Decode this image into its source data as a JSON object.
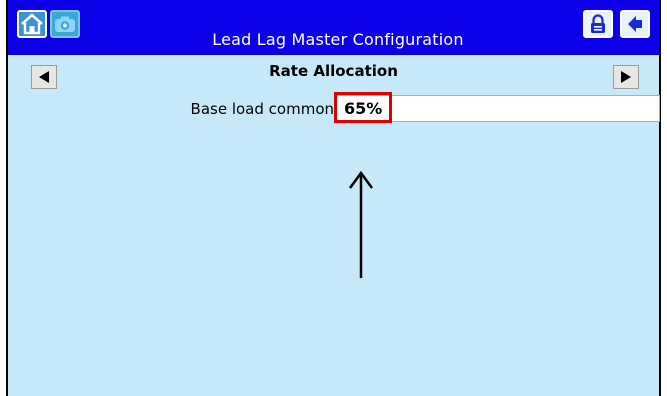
{
  "window": {
    "title": "Lead Lag Master Configuration"
  },
  "toolbar": {
    "home_icon": "home-icon",
    "camera_icon": "camera-icon",
    "lock_icon": "lock-icon",
    "back_icon": "back-arrow-icon"
  },
  "section": {
    "title": "Rate Allocation",
    "prev_icon": "left-arrow-icon",
    "next_icon": "right-arrow-icon"
  },
  "fields": [
    {
      "label": "Base load common",
      "value": "65%"
    }
  ],
  "colors": {
    "titlebar": "#0b00e8",
    "background": "#c6e9fa",
    "highlight": "#e00000"
  },
  "annotation": {
    "arrow_icon": "up-arrow-icon"
  }
}
